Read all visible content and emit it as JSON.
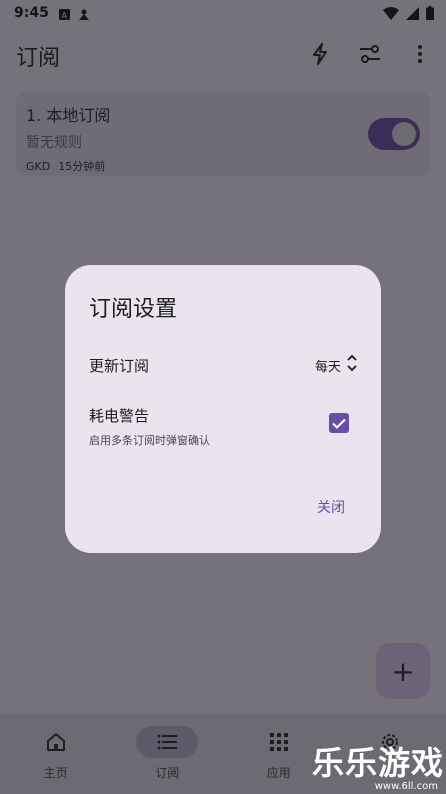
{
  "status_bar": {
    "time": "9:45"
  },
  "app_bar": {
    "title": "订阅"
  },
  "subscription_card": {
    "title": "1. 本地订阅",
    "subtitle": "暂无规则",
    "source": "GKD",
    "updated": "15分钟前",
    "enabled": true
  },
  "fab": {
    "label": "+"
  },
  "bottom_nav": {
    "items": [
      {
        "label": "主页",
        "icon": "home-icon"
      },
      {
        "label": "订阅",
        "icon": "list-icon"
      },
      {
        "label": "应用",
        "icon": "apps-grid-icon"
      },
      {
        "label": "",
        "icon": "settings-icon"
      }
    ],
    "active_index": 1
  },
  "dialog": {
    "title": "订阅设置",
    "update_label": "更新订阅",
    "update_value": "每天",
    "battery_label": "耗电警告",
    "battery_desc": "启用多条订阅时弹窗确认",
    "battery_checked": true,
    "close_label": "关闭"
  },
  "watermark": {
    "text": "乐乐游戏",
    "url": "www.6ll.com"
  },
  "colors": {
    "primary": "#6750a4",
    "dialog_bg": "#e9e4ee",
    "scrim_bg": "#75727b"
  }
}
